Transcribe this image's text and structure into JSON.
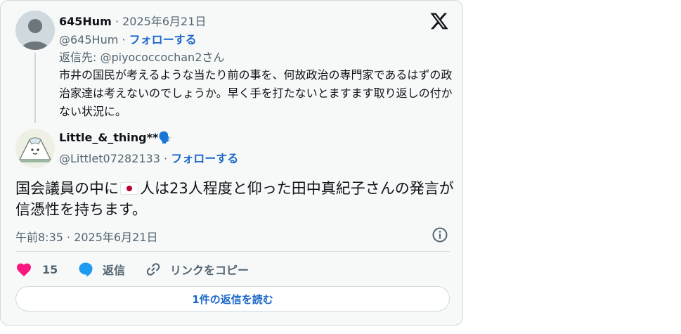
{
  "parent_tweet": {
    "author_name": "645Hum",
    "date": "· 2025年6月21日",
    "handle": "@645Hum",
    "separator": "·",
    "follow_label": "フォローする",
    "reply_to": "返信先: @piyococcochan2さん",
    "text": "市井の国民が考えるような当たり前の事を、何故政治の専門家であるはずの政治家達は考えないのでしょうか。早く手を打たないとますます取り返しの付かない状況に。"
  },
  "main_tweet": {
    "author_name": "Little_&_thing**🗣️",
    "handle": "@Littlet07282133",
    "separator": "·",
    "follow_label": "フォローする",
    "text_before_flag": "国会議員の中に",
    "text_after_flag": "人は23人程度と仰った田中真紀子さんの発言が信憑性を持ちます。",
    "timestamp": "午前8:35 · 2025年6月21日"
  },
  "actions": {
    "like_count": "15",
    "reply_label": "返信",
    "copy_link_label": "リンクをコピー"
  },
  "read_replies_label": "1件の返信を読む",
  "colors": {
    "accent": "#1d68c8",
    "like": "#f91880",
    "reply_icon": "#1d9bf0",
    "muted": "#536471",
    "border": "#cfd9de",
    "card_bg": "#f7f9f9"
  },
  "icons": [
    "x-logo-icon",
    "info-icon",
    "heart-icon",
    "reply-bubble-icon",
    "link-icon",
    "flag-japan-icon"
  ]
}
